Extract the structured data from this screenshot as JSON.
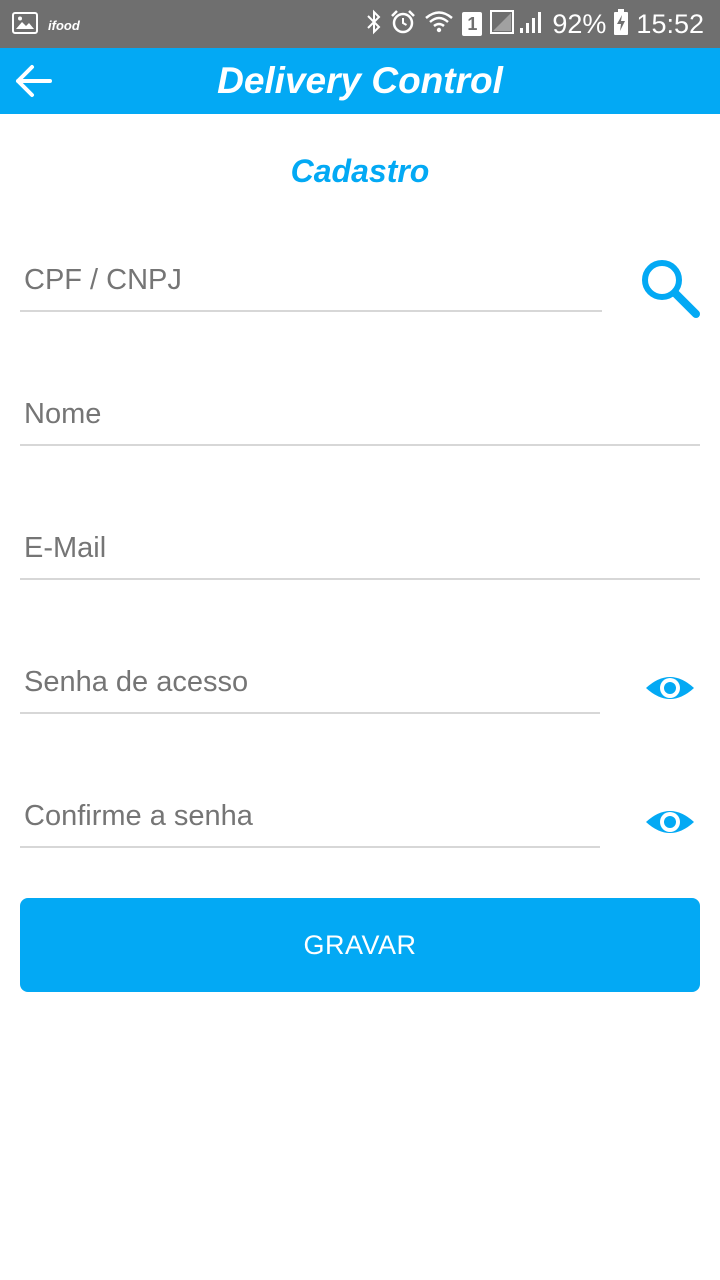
{
  "status_bar": {
    "left_app_label": "ifood",
    "battery": "92%",
    "time": "15:52",
    "sim_slot": "1",
    "icons": [
      "image-icon",
      "bluetooth-icon",
      "alarm-icon",
      "wifi-icon",
      "sim-icon",
      "signal-icon",
      "battery-charging-icon"
    ]
  },
  "app_bar": {
    "title": "Delivery Control",
    "back_icon": "arrow-left-icon"
  },
  "form": {
    "title": "Cadastro",
    "fields": {
      "cpf_cnpj": {
        "placeholder": "CPF / CNPJ",
        "value": ""
      },
      "nome": {
        "placeholder": "Nome",
        "value": ""
      },
      "email": {
        "placeholder": "E-Mail",
        "value": ""
      },
      "senha": {
        "placeholder": "Senha de acesso",
        "value": ""
      },
      "confirma": {
        "placeholder": "Confirme a senha",
        "value": ""
      }
    },
    "search_icon": "search-icon",
    "visibility_icon": "eye-icon",
    "submit_label": "GRAVAR"
  },
  "colors": {
    "accent": "#03a9f4",
    "status_bar": "#6f6f6f",
    "underline": "#d7d7d7",
    "placeholder": "#757575"
  }
}
